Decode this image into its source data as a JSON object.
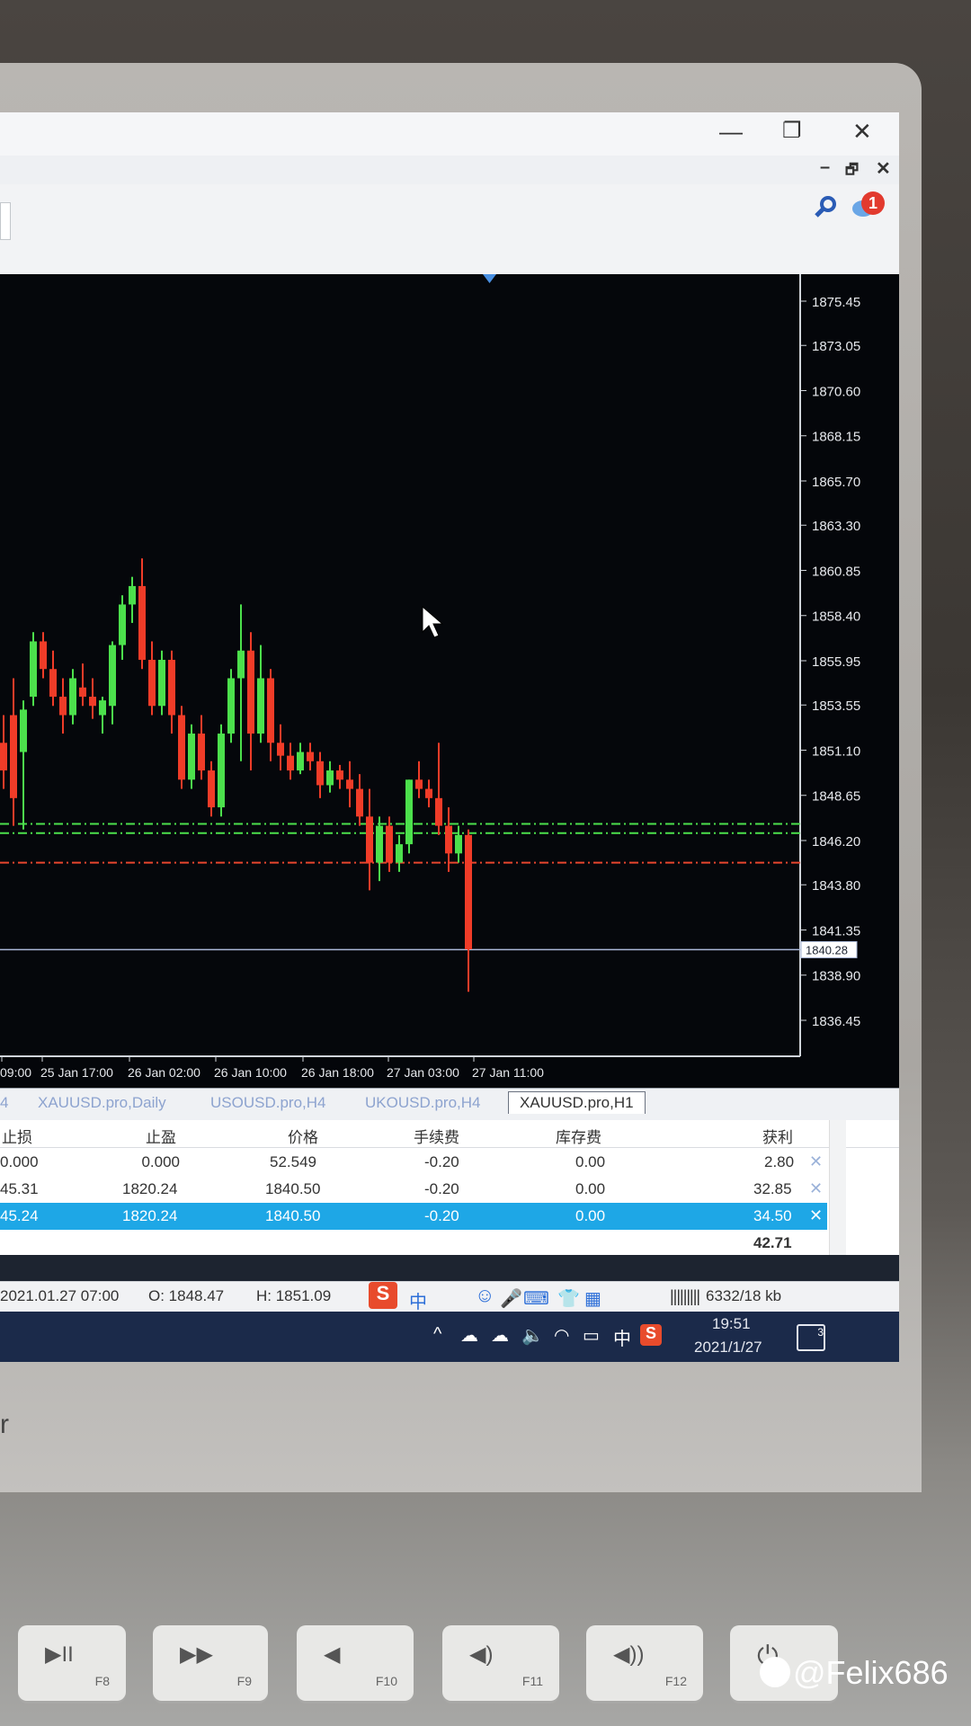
{
  "window": {
    "minimize": "—",
    "maximize": "❐",
    "close": "✕"
  },
  "mdi": {
    "minimize": "–",
    "restore": "🗗",
    "close": "✕"
  },
  "notification": {
    "count": "1"
  },
  "price_axis": {
    "labels": [
      "1875.45",
      "1873.05",
      "1870.60",
      "1868.15",
      "1865.70",
      "1863.30",
      "1860.85",
      "1858.40",
      "1855.95",
      "1853.55",
      "1851.10",
      "1848.65",
      "1846.20",
      "1843.80",
      "1841.35",
      "1838.90",
      "1836.45"
    ],
    "current": "1840.28"
  },
  "time_axis": [
    "09:00",
    "25 Jan 17:00",
    "26 Jan 02:00",
    "26 Jan 10:00",
    "26 Jan 18:00",
    "27 Jan 03:00",
    "27 Jan 11:00"
  ],
  "tabs": [
    {
      "label": "4"
    },
    {
      "label": "XAUUSD.pro,Daily"
    },
    {
      "label": "USOUSD.pro,H4"
    },
    {
      "label": "UKOUSD.pro,H4"
    },
    {
      "label": "XAUUSD.pro,H1"
    }
  ],
  "table": {
    "headers": [
      "止损",
      "止盈",
      "价格",
      "手续费",
      "库存费",
      "获利"
    ],
    "rows": [
      [
        "0.000",
        "0.000",
        "52.549",
        "-0.20",
        "0.00",
        "2.80"
      ],
      [
        "45.31",
        "1820.24",
        "1840.50",
        "-0.20",
        "0.00",
        "32.85"
      ],
      [
        "45.24",
        "1820.24",
        "1840.50",
        "-0.20",
        "0.00",
        "34.50"
      ]
    ],
    "total": "42.71"
  },
  "status": {
    "time": "2021.01.27 07:00",
    "open": "O: 1848.47",
    "high": "H: 1851.09",
    "ime_label": "中",
    "traffic": "6332/18 kb"
  },
  "taskbar": {
    "clock_time": "19:51",
    "clock_date": "2021/1/27",
    "ime": "中",
    "notif_count": "3"
  },
  "keyboard": [
    {
      "fn": "F8",
      "icon": "▶II"
    },
    {
      "fn": "F9",
      "icon": "▶▶"
    },
    {
      "fn": "F10",
      "icon": "◀"
    },
    {
      "fn": "F11",
      "icon": "◀)"
    },
    {
      "fn": "F12",
      "icon": "◀))"
    }
  ],
  "bezel_text": "r",
  "watermark": "@Felix686",
  "chart_data": {
    "type": "candlestick",
    "symbol": "XAUUSD.pro,H1",
    "ylim": [
      1836.45,
      1875.45
    ],
    "levels": {
      "green_dashdot_1": 1847.1,
      "green_dashdot_2": 1846.6,
      "red_dashdot": 1845.0,
      "current_price": 1840.28
    },
    "candles": [
      {
        "o": 1851.5,
        "h": 1853.0,
        "l": 1849.0,
        "c": 1850.0
      },
      {
        "o": 1853.0,
        "h": 1855.0,
        "l": 1847.0,
        "c": 1848.5
      },
      {
        "o": 1851.0,
        "h": 1853.8,
        "l": 1846.8,
        "c": 1853.3
      },
      {
        "o": 1854.0,
        "h": 1857.5,
        "l": 1853.5,
        "c": 1857.0
      },
      {
        "o": 1857.0,
        "h": 1857.5,
        "l": 1855.0,
        "c": 1855.5
      },
      {
        "o": 1855.5,
        "h": 1856.5,
        "l": 1853.5,
        "c": 1854.0
      },
      {
        "o": 1854.0,
        "h": 1855.0,
        "l": 1852.0,
        "c": 1853.0
      },
      {
        "o": 1853.0,
        "h": 1855.5,
        "l": 1852.5,
        "c": 1855.0
      },
      {
        "o": 1854.5,
        "h": 1855.8,
        "l": 1853.5,
        "c": 1854.0
      },
      {
        "o": 1854.0,
        "h": 1855.0,
        "l": 1852.8,
        "c": 1853.5
      },
      {
        "o": 1853.0,
        "h": 1854.0,
        "l": 1852.0,
        "c": 1853.8
      },
      {
        "o": 1853.5,
        "h": 1857.0,
        "l": 1852.5,
        "c": 1856.8
      },
      {
        "o": 1856.8,
        "h": 1859.5,
        "l": 1856.0,
        "c": 1859.0
      },
      {
        "o": 1859.0,
        "h": 1860.5,
        "l": 1858.0,
        "c": 1860.0
      },
      {
        "o": 1860.0,
        "h": 1861.5,
        "l": 1855.5,
        "c": 1856.0
      },
      {
        "o": 1856.0,
        "h": 1857.0,
        "l": 1853.0,
        "c": 1853.5
      },
      {
        "o": 1853.5,
        "h": 1856.5,
        "l": 1853.0,
        "c": 1856.0
      },
      {
        "o": 1856.0,
        "h": 1856.5,
        "l": 1852.0,
        "c": 1853.0
      },
      {
        "o": 1853.0,
        "h": 1853.5,
        "l": 1849.0,
        "c": 1849.5
      },
      {
        "o": 1849.5,
        "h": 1852.5,
        "l": 1849.0,
        "c": 1852.0
      },
      {
        "o": 1852.0,
        "h": 1853.0,
        "l": 1849.5,
        "c": 1850.0
      },
      {
        "o": 1850.0,
        "h": 1850.5,
        "l": 1847.5,
        "c": 1848.0
      },
      {
        "o": 1848.0,
        "h": 1852.5,
        "l": 1847.5,
        "c": 1852.0
      },
      {
        "o": 1852.0,
        "h": 1855.5,
        "l": 1851.5,
        "c": 1855.0
      },
      {
        "o": 1855.0,
        "h": 1859.0,
        "l": 1850.5,
        "c": 1856.5
      },
      {
        "o": 1856.5,
        "h": 1857.5,
        "l": 1850.0,
        "c": 1852.0
      },
      {
        "o": 1852.0,
        "h": 1856.8,
        "l": 1851.5,
        "c": 1855.0
      },
      {
        "o": 1855.0,
        "h": 1855.5,
        "l": 1850.5,
        "c": 1851.5
      },
      {
        "o": 1851.5,
        "h": 1852.5,
        "l": 1850.0,
        "c": 1850.8
      },
      {
        "o": 1850.8,
        "h": 1851.5,
        "l": 1849.5,
        "c": 1850.0
      },
      {
        "o": 1850.0,
        "h": 1851.5,
        "l": 1849.8,
        "c": 1851.0
      },
      {
        "o": 1851.0,
        "h": 1851.5,
        "l": 1850.0,
        "c": 1850.5
      },
      {
        "o": 1850.5,
        "h": 1851.0,
        "l": 1848.5,
        "c": 1849.2
      },
      {
        "o": 1849.2,
        "h": 1850.5,
        "l": 1848.8,
        "c": 1850.0
      },
      {
        "o": 1850.0,
        "h": 1850.3,
        "l": 1849.0,
        "c": 1849.5
      },
      {
        "o": 1849.5,
        "h": 1850.5,
        "l": 1848.0,
        "c": 1849.0
      },
      {
        "o": 1849.0,
        "h": 1849.8,
        "l": 1847.0,
        "c": 1847.5
      },
      {
        "o": 1847.5,
        "h": 1849.0,
        "l": 1843.5,
        "c": 1845.0
      },
      {
        "o": 1845.0,
        "h": 1847.5,
        "l": 1844.0,
        "c": 1847.0
      },
      {
        "o": 1847.0,
        "h": 1847.5,
        "l": 1844.5,
        "c": 1845.0
      },
      {
        "o": 1845.0,
        "h": 1846.5,
        "l": 1844.5,
        "c": 1846.0
      },
      {
        "o": 1846.0,
        "h": 1849.5,
        "l": 1845.5,
        "c": 1849.5
      },
      {
        "o": 1849.5,
        "h": 1850.5,
        "l": 1848.5,
        "c": 1849.0
      },
      {
        "o": 1849.0,
        "h": 1849.5,
        "l": 1848.0,
        "c": 1848.5
      },
      {
        "o": 1848.5,
        "h": 1851.5,
        "l": 1846.5,
        "c": 1847.0
      },
      {
        "o": 1847.0,
        "h": 1848.0,
        "l": 1844.5,
        "c": 1845.5
      },
      {
        "o": 1845.5,
        "h": 1847.0,
        "l": 1845.0,
        "c": 1846.5
      },
      {
        "o": 1846.5,
        "h": 1846.8,
        "l": 1838.0,
        "c": 1840.3
      }
    ]
  }
}
